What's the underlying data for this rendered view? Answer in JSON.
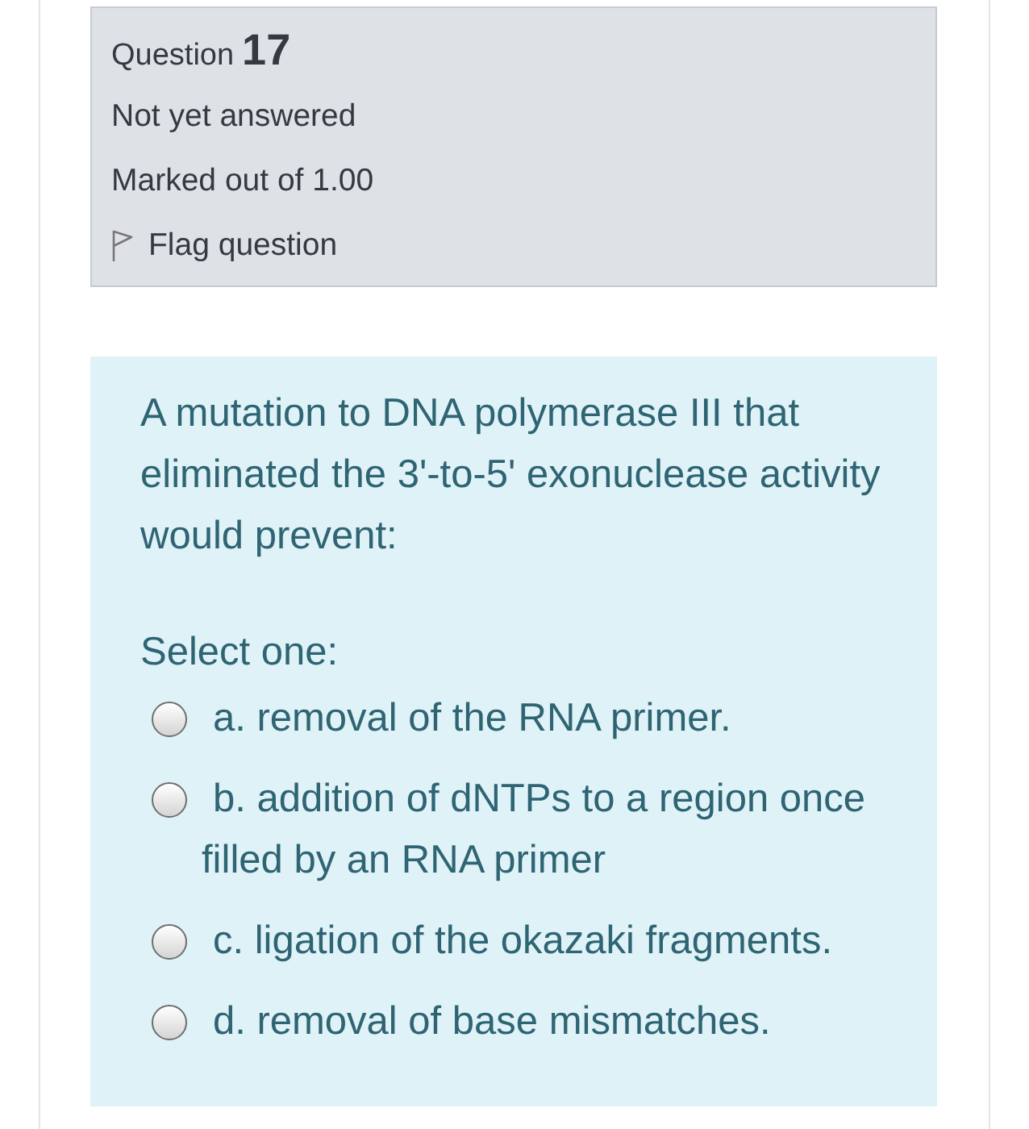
{
  "info": {
    "question_label": "Question",
    "question_number": "17",
    "status": "Not yet answered",
    "marks": "Marked out of 1.00",
    "flag": {
      "label": "Flag question",
      "flagged": false
    }
  },
  "question": {
    "text": "A mutation to DNA polymerase III that eliminated the 3'-to-5' exonuclease activity would prevent:",
    "prompt": "Select one:",
    "options": [
      {
        "label": "a. removal of the RNA primer.",
        "selected": false
      },
      {
        "label": "b. addition of dNTPs to a region once filled by an RNA primer",
        "selected": false
      },
      {
        "label": "c. ligation of the okazaki fragments.",
        "selected": false
      },
      {
        "label": "d. removal of base mismatches.",
        "selected": false
      }
    ]
  }
}
